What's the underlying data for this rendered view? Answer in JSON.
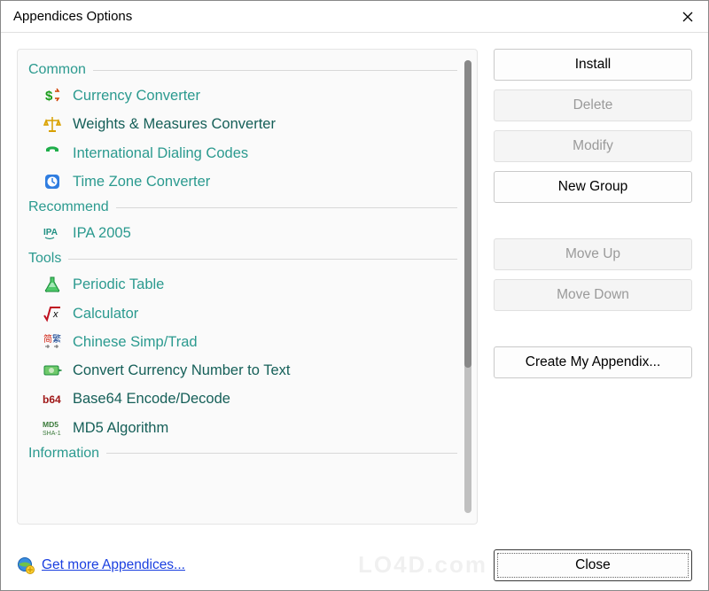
{
  "title": "Appendices Options",
  "groups": [
    {
      "label": "Common",
      "items": [
        {
          "icon": "currency",
          "label": "Currency Converter",
          "dark": false
        },
        {
          "icon": "scales",
          "label": "Weights & Measures Converter",
          "dark": true
        },
        {
          "icon": "phone",
          "label": "International Dialing Codes",
          "dark": false
        },
        {
          "icon": "clock",
          "label": "Time Zone Converter",
          "dark": false
        }
      ]
    },
    {
      "label": "Recommend",
      "items": [
        {
          "icon": "ipa",
          "label": "IPA 2005",
          "dark": false
        }
      ]
    },
    {
      "label": "Tools",
      "items": [
        {
          "icon": "flask",
          "label": "Periodic Table",
          "dark": false
        },
        {
          "icon": "sqrt",
          "label": "Calculator",
          "dark": false
        },
        {
          "icon": "cjk",
          "label": "Chinese Simp/Trad",
          "dark": false
        },
        {
          "icon": "money",
          "label": "Convert Currency Number to Text",
          "dark": true
        },
        {
          "icon": "b64",
          "label": "Base64 Encode/Decode",
          "dark": true
        },
        {
          "icon": "md5",
          "label": "MD5 Algorithm",
          "dark": true
        }
      ]
    },
    {
      "label": "Information",
      "items": []
    }
  ],
  "buttons": {
    "install": "Install",
    "delete": "Delete",
    "modify": "Modify",
    "new_group": "New Group",
    "move_up": "Move Up",
    "move_down": "Move Down",
    "create_appendix": "Create My Appendix...",
    "close": "Close"
  },
  "footer_link": "Get more Appendices...",
  "watermark": "LO4D.com"
}
